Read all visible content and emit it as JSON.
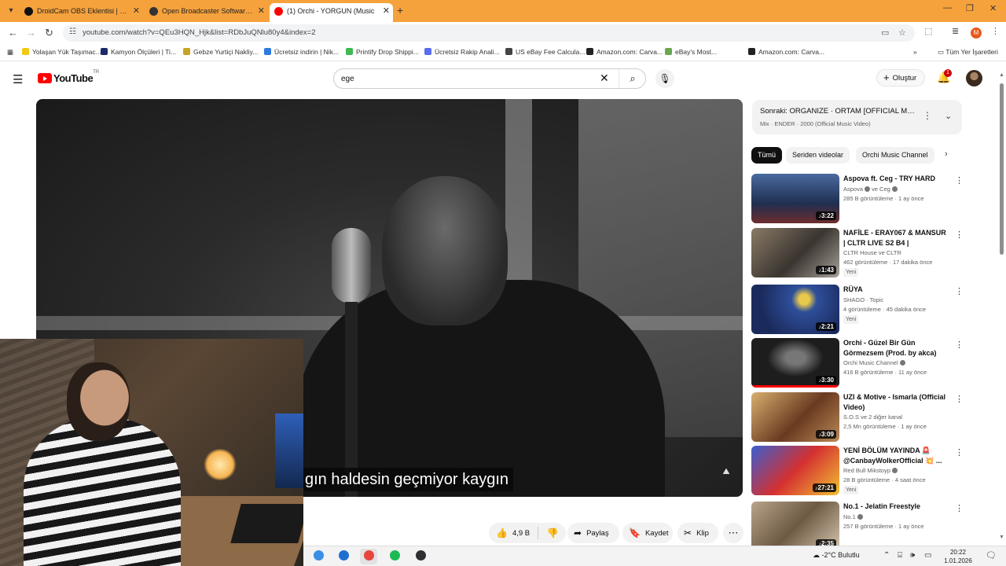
{
  "browser": {
    "tabs": [
      {
        "label": "DroidCam OBS Eklentisi | Dev4",
        "active": false,
        "fav_color": "#111111"
      },
      {
        "label": "Open Broadcaster Software | Ol",
        "active": false,
        "fav_color": "#333333"
      },
      {
        "label": "(1) Orchi - YORGUN (Music",
        "active": true,
        "fav_color": "#ff0000"
      }
    ],
    "url": "youtube.com/watch?v=QEu3HQN_Hjk&list=RDbJuQNlu80y4&index=2",
    "profile_initial": "M",
    "bookmarks": [
      {
        "label": "Yolaşan Yük Taşımac...",
        "color": "#f2c811"
      },
      {
        "label": "Kamyon Ölçüleri | Ti...",
        "color": "#1b2a6b"
      },
      {
        "label": "Gebze Yurtiçi Nakliy...",
        "color": "#c9a227"
      },
      {
        "label": "Ücretsiz indirin | Nik...",
        "color": "#2d7be0"
      },
      {
        "label": "Printify Drop Shippi...",
        "color": "#3fb950"
      },
      {
        "label": "Ücretsiz Rakip Anali...",
        "color": "#5b6cf0"
      },
      {
        "label": "US eBay Fee Calcula...",
        "color": "#444444"
      },
      {
        "label": "Amazon.com: Carva...",
        "color": "#222222"
      },
      {
        "label": "eBay's Most...",
        "color": "#6aa84f"
      },
      {
        "label": "Amazon.com: Carva...",
        "color": "#222222"
      }
    ],
    "bookmarks_all": "Tüm Yer İşaretleri"
  },
  "youtube": {
    "logo_text": "YouTube",
    "country": "TR",
    "search_value": "ege",
    "create_label": "Oluştur",
    "notif_count": "1"
  },
  "video": {
    "subtitle": "gın haldesin geçmiyor kaygın",
    "actions": {
      "like_count": "4,9 B",
      "share": "Paylaş",
      "save": "Kaydet",
      "clip": "Klip"
    }
  },
  "sidebar": {
    "next_title": "Sonraki: ORGANIZE · ORTAM [OFFICIAL MUS...",
    "next_sub": "Mix · ENDER · 2000 (Official Music Video)",
    "chips": [
      "Tümü",
      "Seriden videolar",
      "Orchi Music Channel"
    ],
    "recs": [
      {
        "title": "Aspova ft. Ceg - TRY HARD",
        "channel": "Aspova",
        "channel2": "ve Ceg",
        "verified": true,
        "meta": "285 B görüntüleme · 1 ay önce",
        "duration": "3:22",
        "isnew": false,
        "progress": 0,
        "thumb": "linear-gradient(180deg,#4a6aa0,#1f2f50 60%,#6e2d2d)"
      },
      {
        "title": "NAFİLE - ERAY067 & MANSUR | CLTR LIVE S2 B4 |",
        "channel": "CLTR House ve CLTR",
        "channel2": "",
        "verified": false,
        "meta": "462 görüntüleme · 17 dakika önce",
        "duration": "1:43",
        "isnew": true,
        "progress": 0,
        "thumb": "linear-gradient(135deg,#8a7a66,#3a3530 55%,#a7a39a)"
      },
      {
        "title": "RÜYA",
        "channel": "SHAGO · Topic",
        "channel2": "",
        "verified": false,
        "meta": "4 görüntüleme · 45 dakika önce",
        "duration": "2:21",
        "isnew": true,
        "progress": 0,
        "thumb": "radial-gradient(circle at 60% 30%,#e9c94b 0 8%,#2f4f9a 20%,#1a2a5c 70%)"
      },
      {
        "title": "Orchi - Güzel Bir Gün Görmezsem (Prod. by akca)",
        "channel": "Orchi Music Channel",
        "channel2": "",
        "verified": true,
        "meta": "416 B görüntüleme · 11 ay önce",
        "duration": "3:30",
        "isnew": false,
        "progress": 100,
        "thumb": "radial-gradient(ellipse at 50% 40%,#777 0 15%,#1d1d1d 45%)"
      },
      {
        "title": "UZI & Motive - Ismarla (Official Video)",
        "channel": "S.O.S ve 2 diğer kanal",
        "channel2": "",
        "verified": false,
        "meta": "2,5 Mn görüntüleme · 1 ay önce",
        "duration": "3:09",
        "isnew": false,
        "progress": 0,
        "thumb": "linear-gradient(135deg,#d8b070,#6a3a20 55%,#b98a58)"
      },
      {
        "title": "YENİ BÖLÜM YAYINDA 🚨 @CanbayWolkerOfficial 💥 ...",
        "channel": "Red Bull Mikstoyp",
        "channel2": "",
        "verified": true,
        "meta": "28 B görüntüleme · 4 saat önce",
        "duration": "27:21",
        "isnew": true,
        "progress": 0,
        "thumb": "linear-gradient(135deg,#3a5fd0,#d43030 50%,#f2c233)"
      },
      {
        "title": "No.1 - Jelatin Freestyle",
        "channel": "No.1",
        "channel2": "",
        "verified": true,
        "meta": "257 B görüntüleme · 1 ay önce",
        "duration": "2:35",
        "isnew": false,
        "progress": 0,
        "thumb": "linear-gradient(135deg,#b9a48a,#6d5a44 50%,#d7c7b0)"
      }
    ]
  },
  "taskbar": {
    "weather": "-2°C  Bulutlu",
    "time": "20:22",
    "date": "1.01.2026",
    "apps": [
      {
        "name": "explorer-app",
        "color": "#3a8ee6",
        "active": false
      },
      {
        "name": "edge-app",
        "color": "#1f6fd1",
        "active": false
      },
      {
        "name": "chrome-app",
        "color": "#e8453c",
        "active": true
      },
      {
        "name": "spotify-app",
        "color": "#1db954",
        "active": false
      },
      {
        "name": "obs-app",
        "color": "#302e31",
        "active": false
      }
    ]
  }
}
